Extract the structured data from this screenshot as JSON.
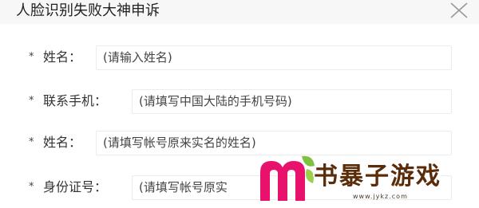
{
  "dialog": {
    "title": "人脸识别失败大神申诉",
    "close_icon": "close-icon"
  },
  "form": {
    "fields": [
      {
        "required_mark": "*",
        "label": "姓名：",
        "placeholder": "(请输入姓名)"
      },
      {
        "required_mark": "*",
        "label": "联系手机：",
        "placeholder": "(请填写中国大陆的手机号码)"
      },
      {
        "required_mark": "*",
        "label": "姓名：",
        "placeholder": "(请填写帐号原来实名的姓名)"
      },
      {
        "required_mark": "*",
        "label": "身份证号：",
        "placeholder": "(请填写帐号原实"
      }
    ]
  },
  "watermark": {
    "brand_text": "书暴子游戏",
    "url": "www.jykz.com",
    "logo_icon": "m-logo-icon",
    "colors": {
      "logo_pink": "#e8126d",
      "leaf_green": "#7fc241",
      "text_brown": "#5b2c0a"
    }
  }
}
